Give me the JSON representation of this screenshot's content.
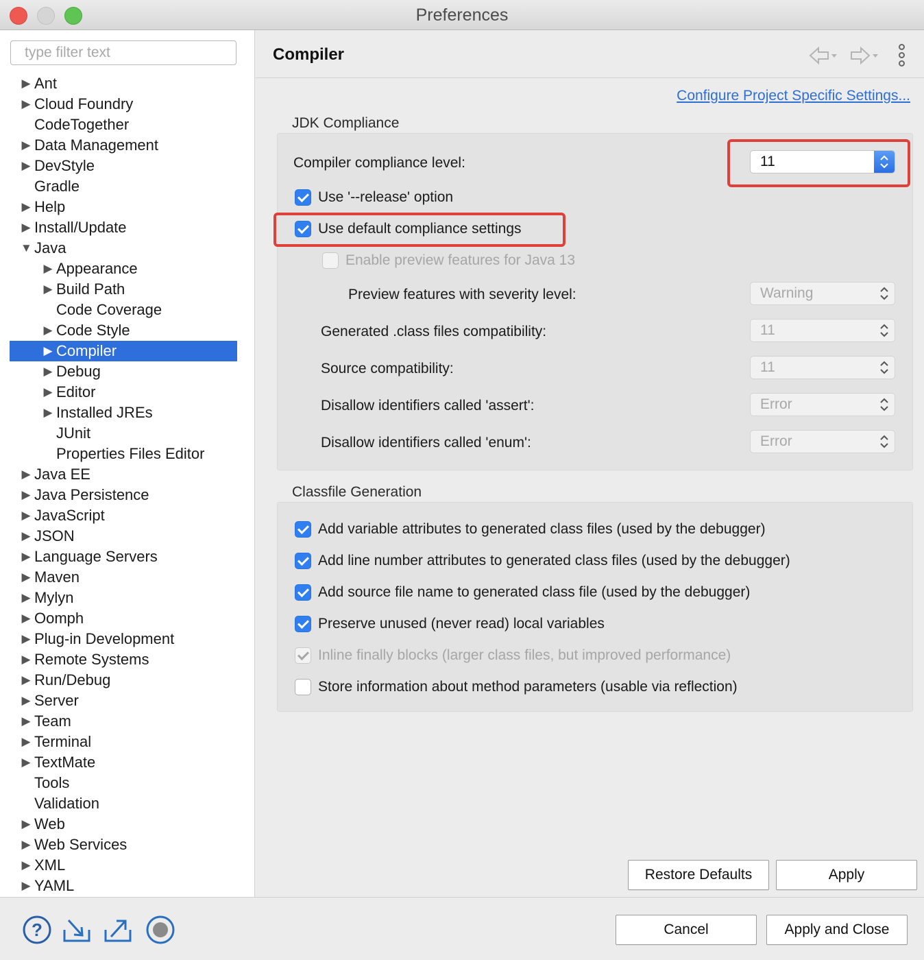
{
  "window": {
    "title": "Preferences"
  },
  "left": {
    "filter_placeholder": "type filter text",
    "tree": [
      {
        "label": "Ant",
        "level": 0,
        "arrow": "right"
      },
      {
        "label": "Cloud Foundry",
        "level": 0,
        "arrow": "right"
      },
      {
        "label": "CodeTogether",
        "level": 0,
        "arrow": "none"
      },
      {
        "label": "Data Management",
        "level": 0,
        "arrow": "right"
      },
      {
        "label": "DevStyle",
        "level": 0,
        "arrow": "right"
      },
      {
        "label": "Gradle",
        "level": 0,
        "arrow": "none"
      },
      {
        "label": "Help",
        "level": 0,
        "arrow": "right"
      },
      {
        "label": "Install/Update",
        "level": 0,
        "arrow": "right"
      },
      {
        "label": "Java",
        "level": 0,
        "arrow": "down"
      },
      {
        "label": "Appearance",
        "level": 1,
        "arrow": "right"
      },
      {
        "label": "Build Path",
        "level": 1,
        "arrow": "right"
      },
      {
        "label": "Code Coverage",
        "level": 1,
        "arrow": "none"
      },
      {
        "label": "Code Style",
        "level": 1,
        "arrow": "right"
      },
      {
        "label": "Compiler",
        "level": 1,
        "arrow": "right",
        "selected": true
      },
      {
        "label": "Debug",
        "level": 1,
        "arrow": "right"
      },
      {
        "label": "Editor",
        "level": 1,
        "arrow": "right"
      },
      {
        "label": "Installed JREs",
        "level": 1,
        "arrow": "right"
      },
      {
        "label": "JUnit",
        "level": 1,
        "arrow": "none"
      },
      {
        "label": "Properties Files Editor",
        "level": 1,
        "arrow": "none"
      },
      {
        "label": "Java EE",
        "level": 0,
        "arrow": "right"
      },
      {
        "label": "Java Persistence",
        "level": 0,
        "arrow": "right"
      },
      {
        "label": "JavaScript",
        "level": 0,
        "arrow": "right"
      },
      {
        "label": "JSON",
        "level": 0,
        "arrow": "right"
      },
      {
        "label": "Language Servers",
        "level": 0,
        "arrow": "right"
      },
      {
        "label": "Maven",
        "level": 0,
        "arrow": "right"
      },
      {
        "label": "Mylyn",
        "level": 0,
        "arrow": "right"
      },
      {
        "label": "Oomph",
        "level": 0,
        "arrow": "right"
      },
      {
        "label": "Plug-in Development",
        "level": 0,
        "arrow": "right"
      },
      {
        "label": "Remote Systems",
        "level": 0,
        "arrow": "right"
      },
      {
        "label": "Run/Debug",
        "level": 0,
        "arrow": "right"
      },
      {
        "label": "Server",
        "level": 0,
        "arrow": "right"
      },
      {
        "label": "Team",
        "level": 0,
        "arrow": "right"
      },
      {
        "label": "Terminal",
        "level": 0,
        "arrow": "right"
      },
      {
        "label": "TextMate",
        "level": 0,
        "arrow": "right"
      },
      {
        "label": "Tools",
        "level": 0,
        "arrow": "none"
      },
      {
        "label": "Validation",
        "level": 0,
        "arrow": "none"
      },
      {
        "label": "Web",
        "level": 0,
        "arrow": "right"
      },
      {
        "label": "Web Services",
        "level": 0,
        "arrow": "right"
      },
      {
        "label": "XML",
        "level": 0,
        "arrow": "right"
      },
      {
        "label": "YAML",
        "level": 0,
        "arrow": "right"
      }
    ]
  },
  "right": {
    "page_title": "Compiler",
    "configure_link": "Configure Project Specific Settings...",
    "jdk": {
      "group_title": "JDK Compliance",
      "compliance_label": "Compiler compliance level:",
      "compliance_value": "11",
      "release_label": "Use '--release' option",
      "default_label": "Use default compliance settings",
      "preview_label": "Enable preview features for Java 13",
      "severity_label": "Preview features with severity level:",
      "severity_value": "Warning",
      "generated_label": "Generated .class files compatibility:",
      "generated_value": "11",
      "source_label": "Source compatibility:",
      "source_value": "11",
      "assert_label": "Disallow identifiers called 'assert':",
      "assert_value": "Error",
      "enum_label": "Disallow identifiers called 'enum':",
      "enum_value": "Error"
    },
    "classfile": {
      "group_title": "Classfile Generation",
      "items": [
        "Add variable attributes to generated class files (used by the debugger)",
        "Add line number attributes to generated class files (used by the debugger)",
        "Add source file name to generated class file (used by the debugger)",
        "Preserve unused (never read) local variables",
        "Inline finally blocks (larger class files, but improved performance)",
        "Store information about method parameters (usable via reflection)"
      ]
    },
    "restore_defaults": "Restore Defaults",
    "apply": "Apply"
  },
  "footer": {
    "cancel": "Cancel",
    "apply_close": "Apply and Close"
  },
  "colors": {
    "selection": "#2e6fdb",
    "accent": "#2f7ff1",
    "highlight": "#e0403a",
    "link": "#2f6fcf"
  },
  "icons": [
    "help-icon",
    "import-icon",
    "export-icon",
    "record-icon",
    "back-arrow-icon",
    "forward-arrow-icon",
    "kebab-menu-icon"
  ]
}
